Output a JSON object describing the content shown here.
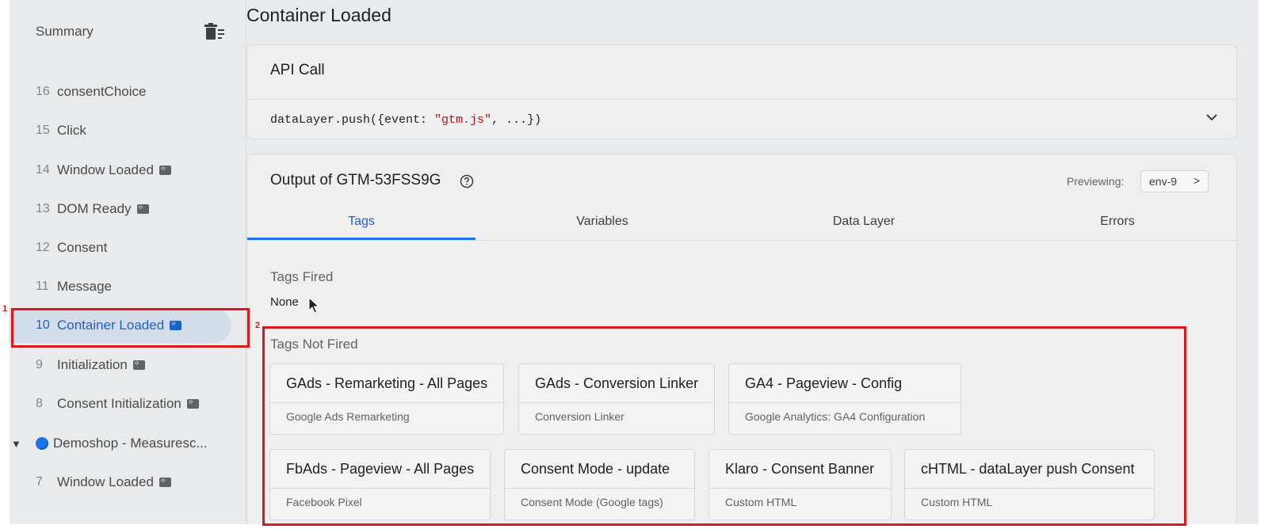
{
  "sidebar": {
    "summary_label": "Summary",
    "summary_icon": "clear-list-icon",
    "events": [
      {
        "num": "16",
        "label": "consentChoice",
        "badge": false
      },
      {
        "num": "15",
        "label": "Click",
        "badge": false
      },
      {
        "num": "14",
        "label": "Window Loaded",
        "badge": true
      },
      {
        "num": "13",
        "label": "DOM Ready",
        "badge": true
      },
      {
        "num": "12",
        "label": "Consent",
        "badge": false
      },
      {
        "num": "11",
        "label": "Message",
        "badge": false
      },
      {
        "num": "10",
        "label": "Container Loaded",
        "badge": true,
        "selected": true
      },
      {
        "num": "9",
        "label": "Initialization",
        "badge": true
      },
      {
        "num": "8",
        "label": "Consent Initialization",
        "badge": true
      }
    ],
    "group": {
      "label": "Demoshop - Measuresc...",
      "icon": "collapse-triangle-icon"
    },
    "after_group": [
      {
        "num": "7",
        "label": "Window Loaded",
        "badge": true
      }
    ]
  },
  "annotations": {
    "box1_num": "1",
    "box2_num": "2",
    "color": "#d81a1f"
  },
  "main": {
    "page_title": "Container Loaded",
    "api_call": {
      "title": "API Call",
      "code_prefix": "dataLayer.push({event: ",
      "code_string": "\"gtm.js\"",
      "code_suffix": ", ...})"
    },
    "output": {
      "title": "Output of GTM-53FSS9G",
      "preview_label": "Previewing:",
      "env_label": "env-9",
      "env_chevron": ">",
      "tabs": [
        {
          "label": "Tags",
          "active": true
        },
        {
          "label": "Variables",
          "active": false
        },
        {
          "label": "Data Layer",
          "active": false
        },
        {
          "label": "Errors",
          "active": false
        }
      ],
      "tags_fired_label": "Tags Fired",
      "tags_fired_value": "None",
      "tags_not_fired_label": "Tags Not Fired",
      "tags_not_fired": [
        {
          "name": "GAds - Remarketing - All Pages",
          "type": "Google Ads Remarketing"
        },
        {
          "name": "GAds - Conversion Linker",
          "type": "Conversion Linker"
        },
        {
          "name": "GA4 - Pageview - Config",
          "type": "Google Analytics: GA4 Configuration"
        },
        {
          "name": "FbAds - Pageview - All Pages",
          "type": "Facebook Pixel"
        },
        {
          "name": "Consent Mode - update",
          "type": "Consent Mode (Google tags)"
        },
        {
          "name": "Klaro - Consent Banner",
          "type": "Custom HTML"
        },
        {
          "name": "cHTML - dataLayer push Consent",
          "type": "Custom HTML"
        }
      ]
    }
  },
  "colors": {
    "accent": "#1a62c6",
    "selected_bg": "#d3dce9",
    "string": "#b31412"
  }
}
